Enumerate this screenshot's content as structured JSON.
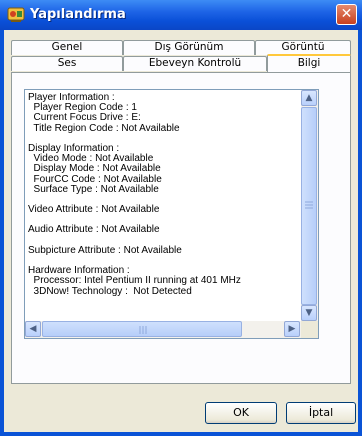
{
  "window": {
    "title": "Yapılandırma",
    "close_glyph": "✕",
    "app_icon": "settings-app-icon"
  },
  "tabs": {
    "back_row": [
      {
        "label": "Genel"
      },
      {
        "label": "Dış Görünüm"
      },
      {
        "label": "Görüntü"
      }
    ],
    "front_row": [
      {
        "label": "Ses"
      },
      {
        "label": "Ebeveyn Kontrolü"
      },
      {
        "label": "Bilgi"
      }
    ],
    "active": "Bilgi"
  },
  "info_lines": [
    "Player Information :",
    "  Player Region Code : 1",
    "  Current Focus Drive : E:",
    "  Title Region Code : Not Available",
    "",
    "Display Information :",
    "  Video Mode : Not Available",
    "  Display Mode : Not Available",
    "  FourCC Code : Not Available",
    "  Surface Type : Not Available",
    "",
    "Video Attribute : Not Available",
    "",
    "Audio Attribute : Not Available",
    "",
    "Subpicture Attribute : Not Available",
    "",
    "Hardware Information :",
    "  Processor: Intel Pentium II running at 401 MHz",
    "  3DNow! Technology :  Not Detected"
  ],
  "buttons": {
    "ok": "OK",
    "cancel": "İptal"
  },
  "colors": {
    "titlebar": "#0a53d6",
    "dialog_bg": "#ece9d8",
    "active_tab_accent": "#ffc83c"
  }
}
